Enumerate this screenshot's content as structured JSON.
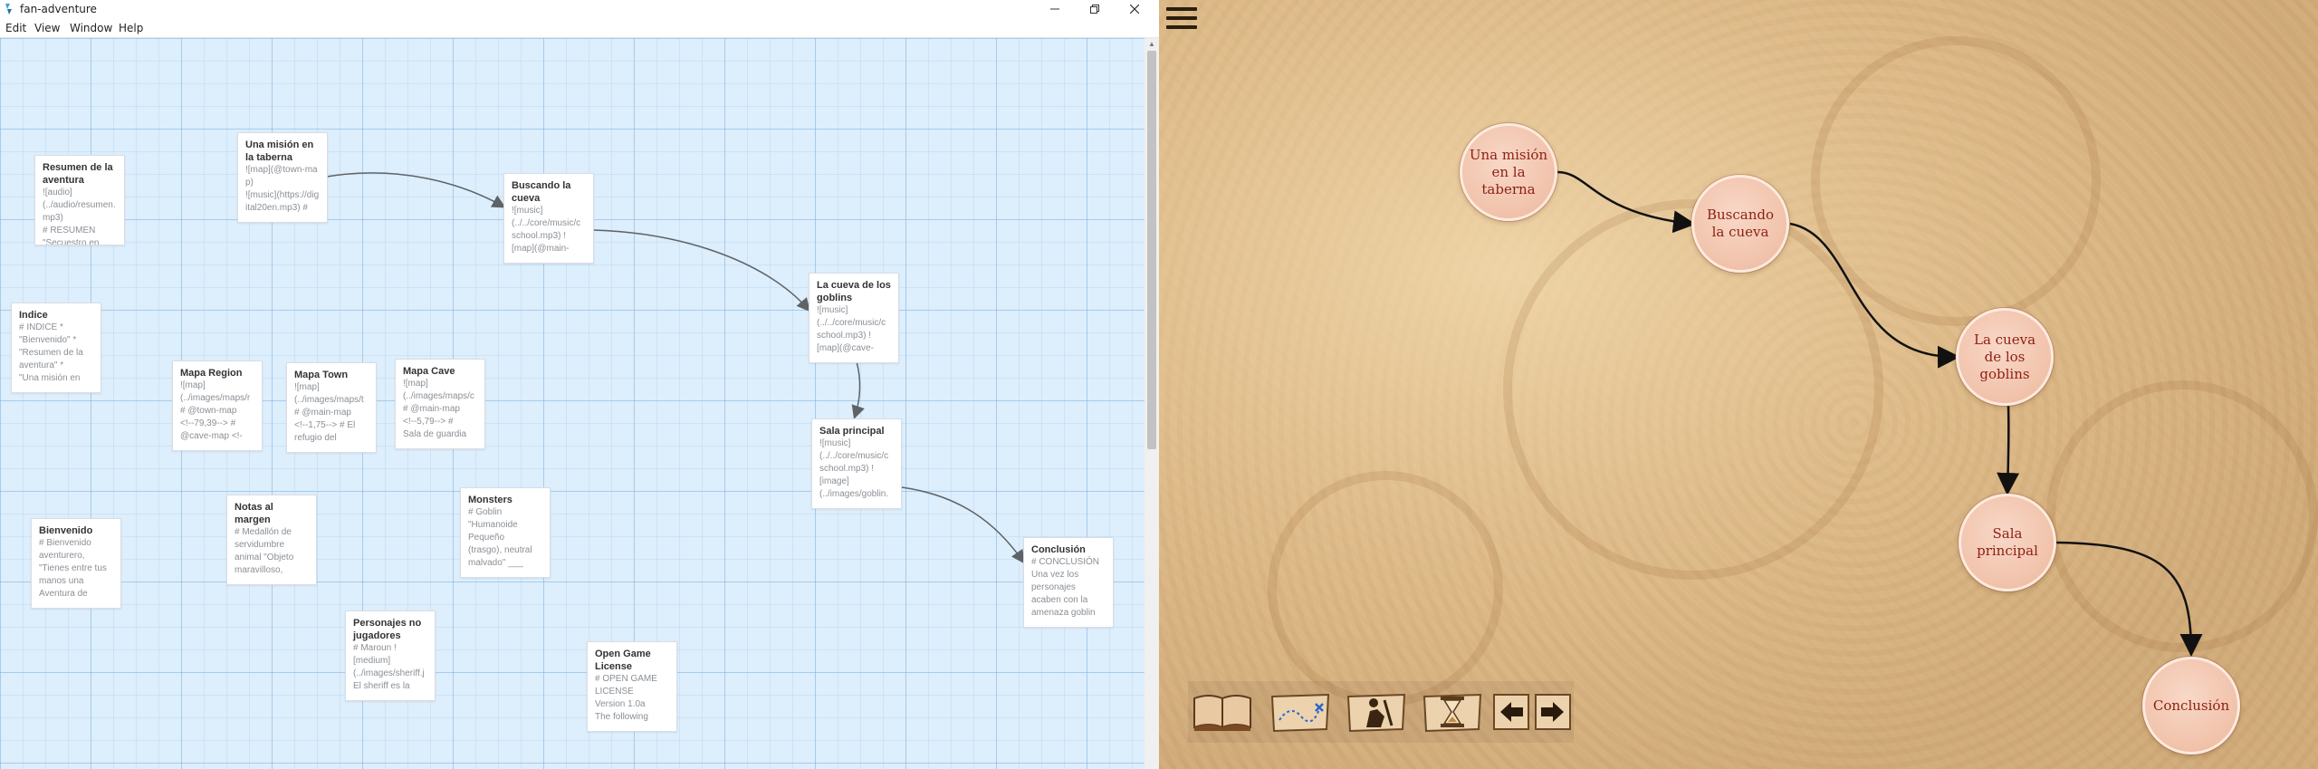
{
  "window": {
    "title": "fan-adventure"
  },
  "menu": [
    "Edit",
    "View",
    "Window",
    "Help"
  ],
  "colors": {
    "grid_bg": "#ddeefc",
    "passage_bg": "#ffffff",
    "node_fill": "#f1c2aa",
    "node_text": "#8e1f14",
    "parchment": "#dcb989"
  },
  "icons": [
    "app-logo-icon",
    "minimize-icon",
    "maximize-icon",
    "close-icon",
    "hamburger-icon",
    "book-icon",
    "map-icon",
    "character-icon",
    "hourglass-icon",
    "arrow-left-icon",
    "arrow-right-icon"
  ],
  "passages": [
    {
      "id": "resumen",
      "title": "Resumen de la aventura",
      "excerpt": "![audio]\n(../audio/resumen.mp3)\n# RESUMEN\n\"Secuestro en"
    },
    {
      "id": "mision",
      "title": "Una misión en la taberna",
      "excerpt": "![map](@town-map)\n![music](https://digital20en.mp3) #"
    },
    {
      "id": "buscando",
      "title": "Buscando la cueva",
      "excerpt": "![music]\n(../../core/music/c\nschool.mp3) !\n[map](@main-"
    },
    {
      "id": "indice",
      "title": "Indice",
      "excerpt": "# INDICE *\n\"Bienvenido\" *\n\"Resumen de la\naventura\" *\n\"Una misión en"
    },
    {
      "id": "cueva",
      "title": "La cueva de los goblins",
      "excerpt": "![music]\n(../../core/music/c\nschool.mp3) !\n[map](@cave-"
    },
    {
      "id": "region",
      "title": "Mapa Region",
      "excerpt": "![map]\n(../images/maps/r\n# @town-map\n<!--79,39--> #\n@cave-map <!-"
    },
    {
      "id": "town",
      "title": "Mapa Town",
      "excerpt": "![map]\n(../images/maps/t\n# @main-map\n<!--1,75--> # El\nrefugio del"
    },
    {
      "id": "cavemap",
      "title": "Mapa Cave",
      "excerpt": "![map]\n(../images/maps/c\n# @main-map\n<!--5,79--> #\nSala de guardia"
    },
    {
      "id": "sala",
      "title": "Sala principal",
      "excerpt": "![music]\n(../../core/music/c\nschool.mp3) !\n[image]\n(../images/goblin."
    },
    {
      "id": "notas",
      "title": "Notas al margen",
      "excerpt": "# Medallón de\nservidumbre\nanimal \"Objeto\nmaravilloso,"
    },
    {
      "id": "monsters",
      "title": "Monsters",
      "excerpt": "# Goblin\n\"Humanoide\nPequeño\n(trasgo), neutral\nmalvado\" ___"
    },
    {
      "id": "bienvenido",
      "title": "Bienvenido",
      "excerpt": "# Bienvenido\naventurero,\n\"Tienes entre tus\nmanos una\nAventura de"
    },
    {
      "id": "conclusion",
      "title": "Conclusión",
      "excerpt": "# CONCLUSIÓN\nUna vez los\npersonajes\nacaben con la\namenaza goblin"
    },
    {
      "id": "personajes",
      "title": "Personajes no jugadores",
      "excerpt": "# Maroun !\n[medium]\n(../images/sheriff.j\nEl sheriff es la"
    },
    {
      "id": "ogl",
      "title": "Open Game License",
      "excerpt": "# OPEN GAME\nLICENSE\nVersion 1.0a\nThe following"
    }
  ],
  "story_nodes": [
    {
      "id": "mision",
      "label": "Una misión en la taberna"
    },
    {
      "id": "buscando",
      "label": "Buscando la cueva"
    },
    {
      "id": "cueva",
      "label": "La cueva de los goblins"
    },
    {
      "id": "sala",
      "label": "Sala principal"
    },
    {
      "id": "conclusion",
      "label": "Conclusión"
    }
  ],
  "story_links": [
    [
      "mision",
      "buscando"
    ],
    [
      "buscando",
      "cueva"
    ],
    [
      "cueva",
      "sala"
    ],
    [
      "sala",
      "conclusion"
    ]
  ]
}
